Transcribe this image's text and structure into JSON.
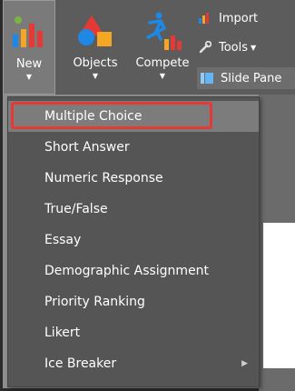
{
  "ribbon": {
    "new": {
      "label": "New",
      "icon": "bar-chart-new-icon"
    },
    "objects": {
      "label": "Objects",
      "icon": "shapes-icon"
    },
    "compete": {
      "label": "Compete",
      "icon": "runner-chart-icon"
    },
    "import": {
      "label": "Import",
      "icon": "import-chart-icon"
    },
    "tools": {
      "label": "Tools",
      "icon": "wrench-icon"
    },
    "slide_pane": {
      "label": "Slide Pane",
      "icon": "slide-pane-icon"
    }
  },
  "menu": {
    "items": [
      {
        "label": "Multiple Choice"
      },
      {
        "label": "Short Answer"
      },
      {
        "label": "Numeric Response"
      },
      {
        "label": "True/False"
      },
      {
        "label": "Essay"
      },
      {
        "label": "Demographic Assignment"
      },
      {
        "label": "Priority Ranking"
      },
      {
        "label": "Likert"
      },
      {
        "label": "Ice Breaker"
      }
    ]
  },
  "colors": {
    "ribbon_bg": "#5c5c5c",
    "menu_bg": "#555555",
    "selected_bg": "#7c7c7c",
    "highlight": "#e53935"
  }
}
